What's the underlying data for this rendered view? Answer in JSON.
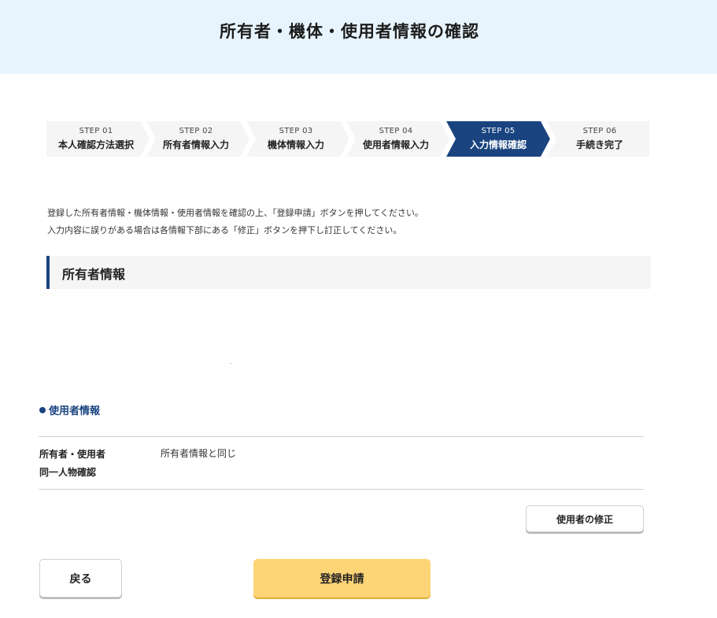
{
  "header": {
    "title": "所有者・機体・使用者情報の確認"
  },
  "steps": [
    {
      "num": "STEP 01",
      "name": "本人確認方法選択",
      "active": false
    },
    {
      "num": "STEP 02",
      "name": "所有者情報入力",
      "active": false
    },
    {
      "num": "STEP 03",
      "name": "機体情報入力",
      "active": false
    },
    {
      "num": "STEP 04",
      "name": "使用者情報入力",
      "active": false
    },
    {
      "num": "STEP 05",
      "name": "入力情報確認",
      "active": true
    },
    {
      "num": "STEP 06",
      "name": "手続き完了",
      "active": false
    }
  ],
  "intro": {
    "line1": "登録した所有者情報・機体情報・使用者情報を確認の上、「登録申請」ボタンを押してください。",
    "line2": "入力内容に誤りがある場合は各情報下部にある「修正」ボタンを押下し訂正してください。"
  },
  "owner_section": {
    "title": "所有者情報"
  },
  "user_section": {
    "title": "使用者情報",
    "row": {
      "label_line1": "所有者・使用者",
      "label_line2": "同一人物確認",
      "value": "所有者情報と同じ"
    },
    "fix_button": "使用者の修正"
  },
  "footer": {
    "back_button": "戻る",
    "submit_button": "登録申請"
  },
  "colors": {
    "accent": "#1a4480",
    "header_bg": "#e8f4fd",
    "submit_bg": "#fed576"
  }
}
